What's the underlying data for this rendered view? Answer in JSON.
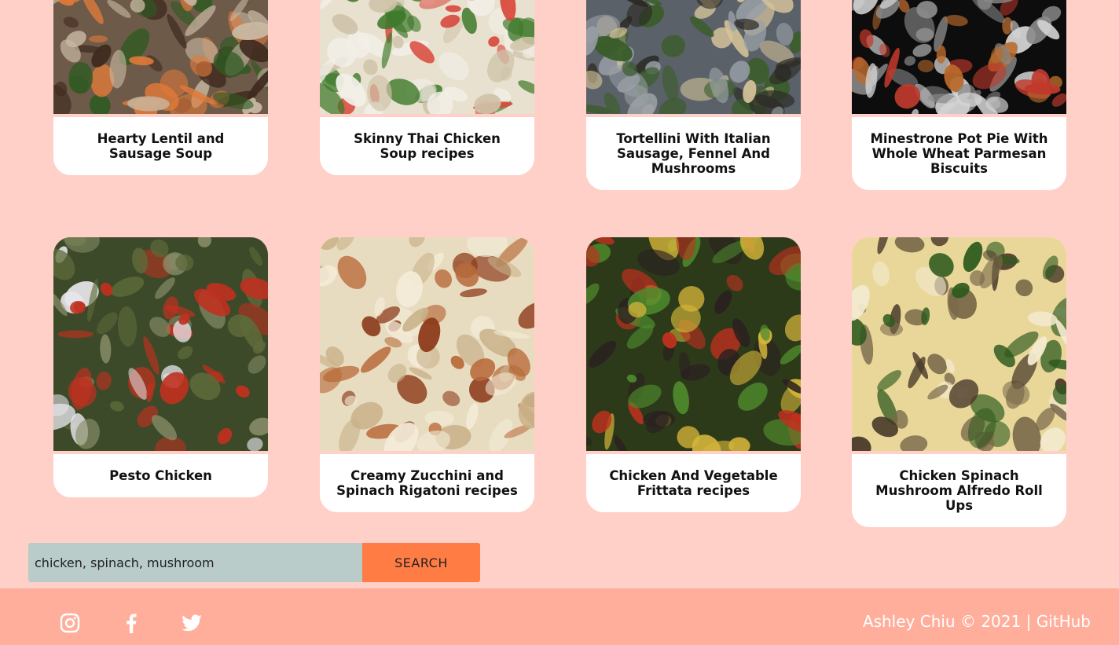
{
  "recipes": [
    {
      "title": "Hearty Lentil and Sausage Soup",
      "image": "lentil-sausage-soup-photo",
      "colors": [
        "#6e5a48",
        "#3f2a1f",
        "#2f5a22",
        "#e07a3a",
        "#c8b9a4"
      ]
    },
    {
      "title": "Skinny Thai Chicken Soup recipes",
      "image": "thai-chicken-soup-photo",
      "colors": [
        "#e9e1cf",
        "#cfc2a8",
        "#3f7a2c",
        "#d8473a",
        "#f2efe8"
      ]
    },
    {
      "title": "Tortellini With Italian Sausage, Fennel And Mushrooms",
      "image": "tortellini-sausage-photo",
      "colors": [
        "#5a6168",
        "#2c2a25",
        "#d7c59a",
        "#3a5d2a",
        "#9aa0a6"
      ]
    },
    {
      "title": "Minestrone Pot Pie With Whole Wheat Parmesan Biscuits",
      "image": "minestrone-pot-pie-photo",
      "colors": [
        "#0d0d0d",
        "#d4d4d4",
        "#b96a2c",
        "#c0392b",
        "#8a8a8a"
      ]
    },
    {
      "title": "Pesto Chicken",
      "image": "pesto-chicken-photo",
      "colors": [
        "#3d4a2a",
        "#5d6a3a",
        "#c0301f",
        "#8a8f6a",
        "#e7e6ea"
      ]
    },
    {
      "title": "Creamy Zucchini and Spinach Rigatoni recipes",
      "image": "zucchini-rigatoni-photo",
      "colors": [
        "#e8dcc0",
        "#f3ecd8",
        "#b86a3a",
        "#8c3a1a",
        "#c9b28a"
      ]
    },
    {
      "title": "Chicken And Vegetable Frittata recipes",
      "image": "chicken-frittata-photo",
      "colors": [
        "#2d3a1a",
        "#d3b43a",
        "#4e8a2c",
        "#2a2020",
        "#c0301f"
      ]
    },
    {
      "title": "Chicken Spinach Mushroom Alfredo Roll Ups",
      "image": "alfredo-roll-ups-photo",
      "colors": [
        "#e9d79a",
        "#4a3a2a",
        "#f3ead0",
        "#7a6a4a",
        "#2e5a1e"
      ]
    }
  ],
  "search": {
    "value": "chicken, spinach, mushroom",
    "placeholder": "",
    "button_label": "SEARCH"
  },
  "footer": {
    "social": [
      {
        "icon": "instagram-icon"
      },
      {
        "icon": "facebook-icon"
      },
      {
        "icon": "twitter-icon"
      }
    ],
    "credit_text": "Ashley Chiu © 2021 | ",
    "github_label": "GitHub"
  },
  "theme": {
    "background": "#ffd0c8",
    "footer": "#ffae9b",
    "accent": "#ff7d45",
    "input": "#b9ccca"
  }
}
